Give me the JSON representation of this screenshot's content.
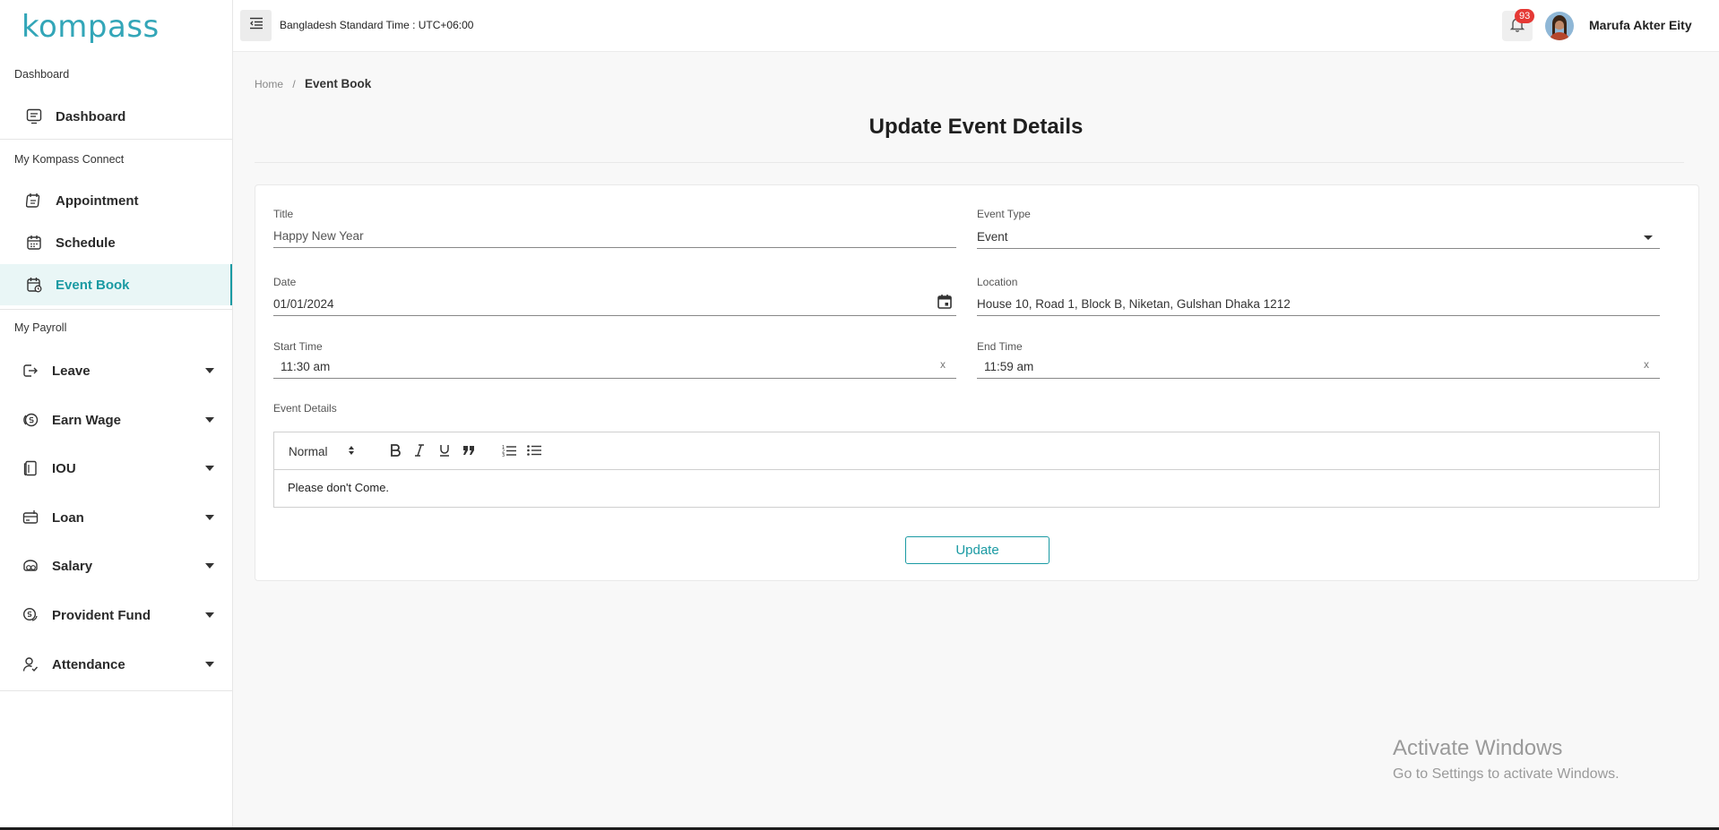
{
  "brand": {
    "logo_text": "kompass",
    "accent": "#1a9aa3"
  },
  "sidebar": {
    "section_dashboard": "Dashboard",
    "section_connect": "My Kompass Connect",
    "section_payroll": "My Payroll",
    "items": [
      {
        "label": "Dashboard",
        "icon": "dashboard-icon"
      },
      {
        "label": "Appointment",
        "icon": "appointment-icon"
      },
      {
        "label": "Schedule",
        "icon": "calendar-icon"
      },
      {
        "label": "Event Book",
        "icon": "event-book-icon",
        "active": true
      },
      {
        "label": "Leave",
        "icon": "leave-icon"
      },
      {
        "label": "Earn Wage",
        "icon": "earn-wage-icon"
      },
      {
        "label": "IOU",
        "icon": "iou-icon"
      },
      {
        "label": "Loan",
        "icon": "loan-icon"
      },
      {
        "label": "Salary",
        "icon": "salary-icon"
      },
      {
        "label": "Provident Fund",
        "icon": "provident-fund-icon"
      },
      {
        "label": "Attendance",
        "icon": "attendance-icon"
      }
    ]
  },
  "header": {
    "timezone": "Bangladesh Standard Time : UTC+06:00",
    "notifications_count": "93",
    "user_name": "Marufa Akter Eity"
  },
  "breadcrumb": {
    "home": "Home",
    "separator": "/",
    "current": "Event Book"
  },
  "page": {
    "title": "Update Event Details"
  },
  "form": {
    "title_label": "Title",
    "title_value": "Happy New Year",
    "event_type_label": "Event Type",
    "event_type_value": "Event",
    "date_label": "Date",
    "date_value": "01/01/2024",
    "location_label": "Location",
    "location_value": "House 10, Road 1, Block B, Niketan, Gulshan Dhaka 1212",
    "start_time_label": "Start Time",
    "start_time_value": "11:30 am",
    "end_time_label": "End Time",
    "end_time_value": "11:59 am",
    "clear_symbol": "x",
    "details_label": "Event Details",
    "editor_format": "Normal",
    "details_value": "Please don't Come.",
    "update_label": "Update"
  },
  "watermark": {
    "line1": "Activate Windows",
    "line2": "Go to Settings to activate Windows."
  }
}
